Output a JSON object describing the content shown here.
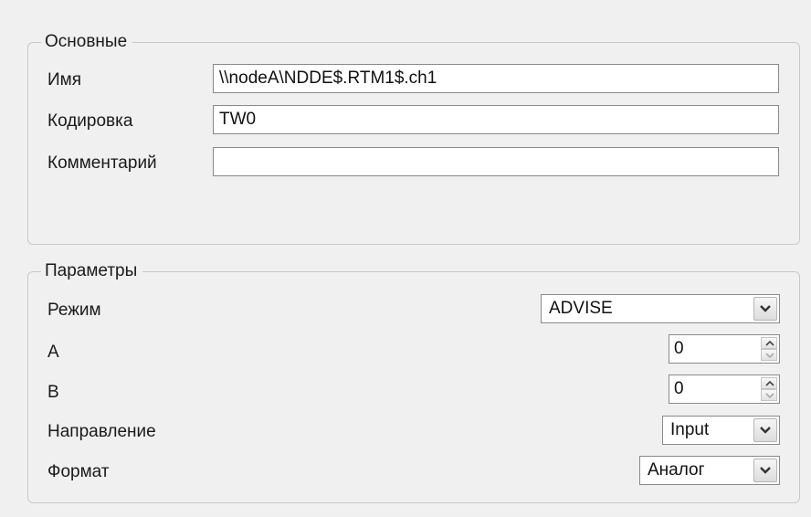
{
  "basic_group": {
    "title": "Основные",
    "name_label": "Имя",
    "name_value": "\\\\nodeA\\NDDE$.RTM1$.ch1",
    "encoding_label": "Кодировка",
    "encoding_value": "TW0",
    "comment_label": "Комментарий",
    "comment_value": ""
  },
  "params_group": {
    "title": "Параметры",
    "mode_label": "Режим",
    "mode_value": "ADVISE",
    "a_label": "A",
    "a_value": "0",
    "b_label": "B",
    "b_value": "0",
    "direction_label": "Направление",
    "direction_value": "Input",
    "format_label": "Формат",
    "format_value": "Аналог"
  },
  "icons": {
    "dropdown": "chevron-down-icon",
    "spin_up": "arrow-up-icon",
    "spin_down": "arrow-down-icon"
  }
}
